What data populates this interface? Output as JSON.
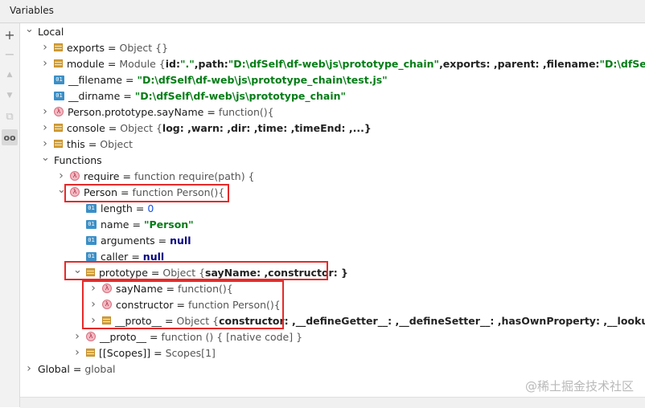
{
  "panel": {
    "title": "Variables"
  },
  "toolbar": [
    {
      "name": "add-watch-button",
      "icon": "+"
    },
    {
      "name": "remove-watch-button",
      "icon": "−"
    },
    {
      "name": "move-up-button",
      "icon": "▲"
    },
    {
      "name": "move-down-button",
      "icon": "▼"
    },
    {
      "name": "copy-button",
      "icon": "⧉"
    },
    {
      "name": "watches-toggle-button",
      "icon": "oo"
    }
  ],
  "tree": [
    {
      "indent": 0,
      "arrow": "down",
      "icon": "none",
      "name": "Local",
      "parts": []
    },
    {
      "indent": 1,
      "arrow": "right",
      "icon": "obj",
      "name": "exports",
      "parts": [
        [
          "val",
          "Object {}"
        ]
      ]
    },
    {
      "indent": 1,
      "arrow": "right",
      "icon": "obj",
      "name": "module",
      "parts": [
        [
          "val",
          "Module {"
        ],
        [
          "bold",
          "id: "
        ],
        [
          "str",
          "\".\""
        ],
        [
          "bold",
          ",path: "
        ],
        [
          "str",
          "\"D:\\dfSelf\\df-web\\js\\prototype_chain\""
        ],
        [
          "bold",
          ",exports: ,parent: ,filename: "
        ],
        [
          "str",
          "\"D:\\dfSelf\\df-web\\js"
        ]
      ]
    },
    {
      "indent": 1,
      "arrow": "none",
      "icon": "prim",
      "name": "__filename",
      "parts": [
        [
          "str",
          "\"D:\\dfSelf\\df-web\\js\\prototype_chain\\test.js\""
        ]
      ]
    },
    {
      "indent": 1,
      "arrow": "none",
      "icon": "prim",
      "name": "__dirname",
      "parts": [
        [
          "str",
          "\"D:\\dfSelf\\df-web\\js\\prototype_chain\""
        ]
      ]
    },
    {
      "indent": 1,
      "arrow": "right",
      "icon": "fn",
      "name": "Person.prototype.sayName",
      "parts": [
        [
          "val",
          "function(){"
        ]
      ]
    },
    {
      "indent": 1,
      "arrow": "right",
      "icon": "obj",
      "name": "console",
      "parts": [
        [
          "val",
          "Object {"
        ],
        [
          "bold",
          "log: ,warn: ,dir: ,time: ,timeEnd: ,...}"
        ]
      ]
    },
    {
      "indent": 1,
      "arrow": "right",
      "icon": "obj",
      "name": "this",
      "parts": [
        [
          "val",
          "Object"
        ]
      ]
    },
    {
      "indent": 1,
      "arrow": "down",
      "icon": "none",
      "name": "Functions",
      "parts": []
    },
    {
      "indent": 2,
      "arrow": "right",
      "icon": "fn",
      "name": "require",
      "parts": [
        [
          "val",
          "function require(path) {"
        ]
      ]
    },
    {
      "indent": 2,
      "arrow": "down",
      "icon": "fn",
      "name": "Person",
      "parts": [
        [
          "val",
          "function Person(){"
        ]
      ]
    },
    {
      "indent": 3,
      "arrow": "none",
      "icon": "prim",
      "name": "length",
      "parts": [
        [
          "num",
          "0"
        ]
      ]
    },
    {
      "indent": 3,
      "arrow": "none",
      "icon": "prim",
      "name": "name",
      "parts": [
        [
          "str",
          "\"Person\""
        ]
      ]
    },
    {
      "indent": 3,
      "arrow": "none",
      "icon": "prim",
      "name": "arguments",
      "parts": [
        [
          "kw",
          "null"
        ]
      ]
    },
    {
      "indent": 3,
      "arrow": "none",
      "icon": "prim",
      "name": "caller",
      "parts": [
        [
          "kw",
          "null"
        ]
      ]
    },
    {
      "indent": 3,
      "arrow": "down",
      "icon": "obj",
      "name": "prototype",
      "parts": [
        [
          "val",
          "Object {"
        ],
        [
          "bold",
          "sayName: ,constructor: }"
        ]
      ]
    },
    {
      "indent": 4,
      "arrow": "right",
      "icon": "fn",
      "name": "sayName",
      "parts": [
        [
          "val",
          "function(){"
        ]
      ]
    },
    {
      "indent": 4,
      "arrow": "right",
      "icon": "fn",
      "name": "constructor",
      "parts": [
        [
          "val",
          "function Person(){"
        ]
      ]
    },
    {
      "indent": 4,
      "arrow": "right",
      "icon": "obj",
      "name": "__proto__",
      "parts": [
        [
          "val",
          "Object {"
        ],
        [
          "bold",
          "constructor: ,__defineGetter__: ,__defineSetter__: ,hasOwnProperty: ,__lookupGetter__: ,...}"
        ]
      ]
    },
    {
      "indent": 3,
      "arrow": "right",
      "icon": "fn",
      "name": "__proto__",
      "parts": [
        [
          "val",
          "function () { [native code] }"
        ]
      ]
    },
    {
      "indent": 3,
      "arrow": "right",
      "icon": "obj",
      "name": "[[Scopes]]",
      "parts": [
        [
          "val",
          "Scopes[1]"
        ]
      ]
    },
    {
      "indent": 0,
      "arrow": "right",
      "icon": "none",
      "name": "Global",
      "parts": [
        [
          "val",
          "global"
        ]
      ]
    }
  ],
  "watermark": "@稀土掘金技术社区",
  "colors": {
    "highlight": "#e52a2a",
    "string": "#067d17",
    "keyword": "#000080",
    "number": "#1750eb"
  }
}
